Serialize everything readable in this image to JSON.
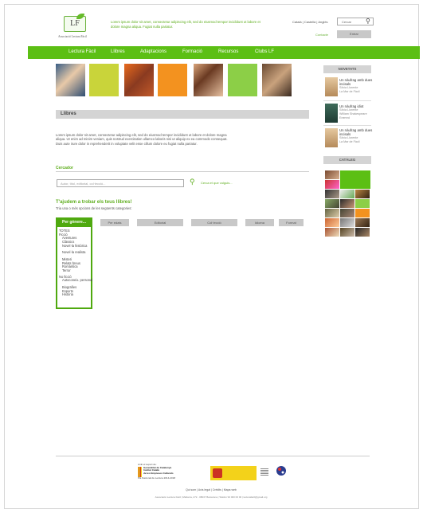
{
  "header": {
    "logo_text": "LF",
    "association": "Associació Lectura Fàcil",
    "tagline": "Lorem ipsum dolor sit amet, consectetur adipiscing elit, sed do eiusmod tempor incididunt ut labore et dolore magna aliqua. Fugiat nulla pariatur.",
    "languages": "Català | Castellà | Anglès",
    "search_placeholder": "Cercar",
    "contact_label": "Contacte",
    "enter_label": "Entrar"
  },
  "nav": {
    "items": [
      "Lectura Fàcil",
      "Llibres",
      "Adaptacions",
      "Formació",
      "Recursos",
      "Clubs LF"
    ]
  },
  "main": {
    "section_title": "Llibres",
    "intro": "Lorem ipsum dolor sit amet, consectetur adipiscing elit, sed do eiusmod tempor incididunt ut labore et dolore magna aliqua. Ut enim ad minim veniam, quis nostrud exercitation ullamco laboris nisi ut aliquip ex ea commodo consequat. Duis aute irure dolor in reprehenderit in voluptate velit esse cillum dolore eu fugiat nulla pariatur.",
    "cercador_title": "Cercador",
    "author_placeholder": "Autor, títol, editorial, col·lecció...",
    "search_link": "Cerca el que vulguis...",
    "finder_title": "T'ajudem a trobar els teus llibres!",
    "finder_subtitle": "Tria una o més opcions de les següents categories:",
    "filters": [
      "Per edats",
      "Editorial",
      "Col·lecció",
      "Idioma",
      "Format"
    ],
    "dropdown_label": "Per gènere...",
    "dropdown_items": [
      {
        "label": "TOTES",
        "sub": false
      },
      {
        "label": "Ficció",
        "sub": false
      },
      {
        "label": "Aventures",
        "sub": true
      },
      {
        "label": "Clàssics",
        "sub": true
      },
      {
        "label": "Novel·la històrica",
        "sub": true
      },
      {
        "label": "Novel·la realista",
        "sub": true
      },
      {
        "label": "Misteri",
        "sub": true
      },
      {
        "label": "Relats breus",
        "sub": true
      },
      {
        "label": "Romàntica",
        "sub": true
      },
      {
        "label": "Terror",
        "sub": true
      },
      {
        "label": "No ficció",
        "sub": false
      },
      {
        "label": "Autoconeix. personal",
        "sub": true
      },
      {
        "label": "Biografies",
        "sub": true
      },
      {
        "label": "Esports",
        "sub": true
      },
      {
        "label": "Història",
        "sub": true
      }
    ]
  },
  "sidebar": {
    "news_title": "NOVETATS",
    "books": [
      {
        "title": "Un nàufrag amb dues incisals",
        "author": "Sílvia Llorente",
        "publisher": "La Mar de Fàcil"
      },
      {
        "title": "Un nàufrag idiot",
        "author": "Sílvia Llorente",
        "publisher": "William Shakespeare Enemrd"
      },
      {
        "title": "Un nàufrag amb dues incisals",
        "author": "Sílvia Llorente",
        "publisher": "La Mar de Fàcil"
      }
    ],
    "catalog_title": "CATÀLEG"
  },
  "footer": {
    "gencat_lines": [
      "Amb el suport de:",
      "Generalitat de Catalunya",
      "Institut Català",
      "de les Empreses Culturals",
      "Pla Nacional de Lectura 2014-2018"
    ],
    "links": "Qui som | Avís legal | Crèdits | Mapa web",
    "address": "Associació Lectura Fàcil | Mallorca, 272 - 08037 Barcelona | Telèfon 93 000 00 00 | lecturafacil@gmail.org"
  },
  "colors": {
    "brand_green": "#5cbf14",
    "gray_bar": "#d4d4d4"
  }
}
